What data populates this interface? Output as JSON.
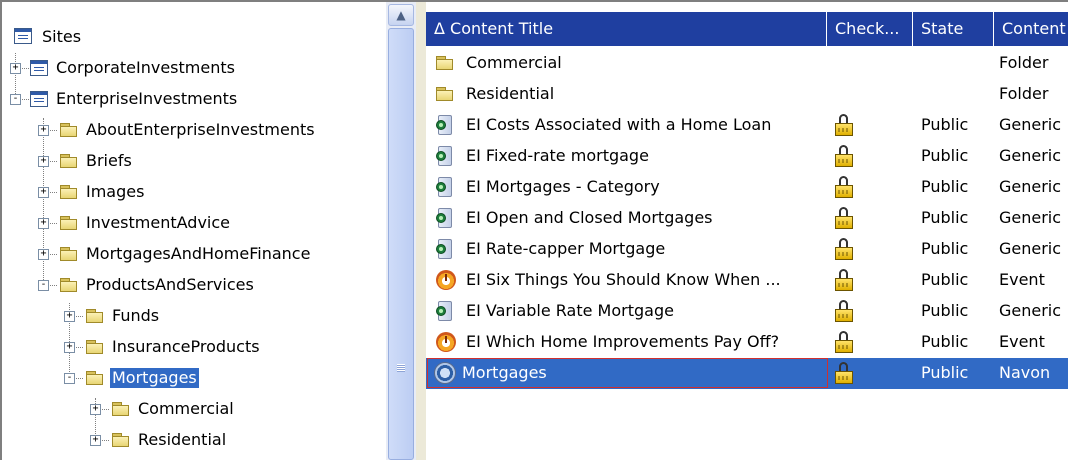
{
  "tree": {
    "root_label": "Sites",
    "items": [
      {
        "label": "CorporateInvestments",
        "icon": "site-icon",
        "expander": "+"
      },
      {
        "label": "EnterpriseInvestments",
        "icon": "site-icon",
        "expander": "-"
      },
      {
        "label": "AboutEnterpriseInvestments",
        "icon": "folder-icon",
        "expander": "+"
      },
      {
        "label": "Briefs",
        "icon": "folder-icon",
        "expander": "+"
      },
      {
        "label": "Images",
        "icon": "folder-icon",
        "expander": "+"
      },
      {
        "label": "InvestmentAdvice",
        "icon": "folder-icon",
        "expander": "+"
      },
      {
        "label": "MortgagesAndHomeFinance",
        "icon": "folder-icon",
        "expander": "+"
      },
      {
        "label": "ProductsAndServices",
        "icon": "folder-icon",
        "expander": "-"
      },
      {
        "label": "Funds",
        "icon": "folder-icon",
        "expander": "+"
      },
      {
        "label": "InsuranceProducts",
        "icon": "folder-icon",
        "expander": "+"
      },
      {
        "label": "Mortgages",
        "icon": "folder-icon",
        "expander": "-",
        "selected": true
      },
      {
        "label": "Commercial",
        "icon": "folder-icon",
        "expander": "+"
      },
      {
        "label": "Residential",
        "icon": "folder-icon",
        "expander": "+"
      }
    ]
  },
  "scrollbar": {
    "up_arrow": "▲"
  },
  "list": {
    "headers": {
      "sort_indicator": "Δ",
      "title": "Content Title",
      "checkout": "Check...",
      "state": "State",
      "content_type": "Content"
    },
    "rows": [
      {
        "icon": "folder-icon",
        "title": "Commercial",
        "locked": false,
        "state": "",
        "type": "Folder"
      },
      {
        "icon": "folder-icon",
        "title": "Residential",
        "locked": false,
        "state": "",
        "type": "Folder"
      },
      {
        "icon": "generic-doc-icon",
        "title": "EI Costs Associated with a Home Loan",
        "locked": true,
        "state": "Public",
        "type": "Generic"
      },
      {
        "icon": "generic-doc-icon",
        "title": "EI Fixed-rate mortgage",
        "locked": true,
        "state": "Public",
        "type": "Generic"
      },
      {
        "icon": "generic-doc-icon",
        "title": "EI Mortgages - Category",
        "locked": true,
        "state": "Public",
        "type": "Generic"
      },
      {
        "icon": "generic-doc-icon",
        "title": "EI Open and Closed Mortgages",
        "locked": true,
        "state": "Public",
        "type": "Generic"
      },
      {
        "icon": "generic-doc-icon",
        "title": "EI Rate-capper Mortgage",
        "locked": true,
        "state": "Public",
        "type": "Generic"
      },
      {
        "icon": "event-icon",
        "title": "EI Six Things You Should Know When ...",
        "locked": true,
        "state": "Public",
        "type": "Event"
      },
      {
        "icon": "generic-doc-icon",
        "title": "EI Variable Rate Mortgage",
        "locked": true,
        "state": "Public",
        "type": "Generic"
      },
      {
        "icon": "event-icon",
        "title": "EI Which Home Improvements Pay Off?",
        "locked": true,
        "state": "Public",
        "type": "Event"
      },
      {
        "icon": "navon-icon",
        "title": "Mortgages",
        "locked": true,
        "state": "Public",
        "type": "Navon",
        "selected": true
      }
    ]
  },
  "colors": {
    "header_bg": "#1f3fa0",
    "selection_bg": "#316ac5",
    "selection_border": "#d03030"
  }
}
